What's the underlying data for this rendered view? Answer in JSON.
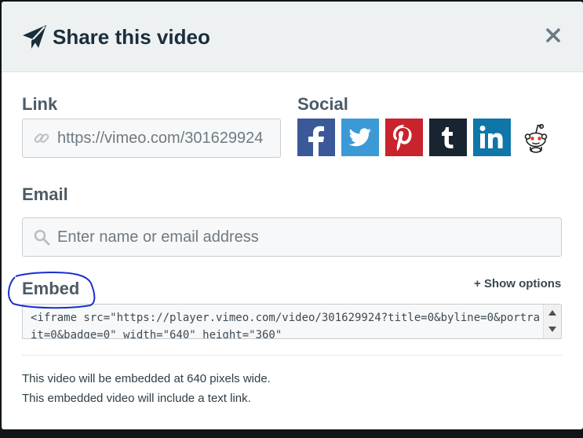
{
  "dialog": {
    "title": "Share this video",
    "close_label": "×"
  },
  "link": {
    "label": "Link",
    "value": "https://vimeo.com/301629924"
  },
  "social": {
    "label": "Social",
    "buttons": [
      {
        "name": "facebook",
        "color": "#3b5998"
      },
      {
        "name": "twitter",
        "color": "#3b9ad6"
      },
      {
        "name": "pinterest",
        "color": "#c9232d"
      },
      {
        "name": "tumblr",
        "color": "#18242f"
      },
      {
        "name": "linkedin",
        "color": "#0e76a8"
      },
      {
        "name": "reddit",
        "color": "#ffffff"
      }
    ]
  },
  "email": {
    "label": "Email",
    "placeholder": "Enter name or email address"
  },
  "embed": {
    "label": "Embed",
    "show_options": "+ Show options",
    "code": "<iframe src=\"https://player.vimeo.com/video/301629924?title=0&byline=0&portrait=0&badge=0\" width=\"640\" height=\"360\""
  },
  "notes": {
    "width_note": "This video will be embedded at 640 pixels wide.",
    "link_note": "This embedded video will include a text link."
  },
  "colors": {
    "header_bg": "#eef1f2",
    "title": "#1a2e3b",
    "label": "#4d5b65",
    "annotation": "#1a2fd0"
  }
}
